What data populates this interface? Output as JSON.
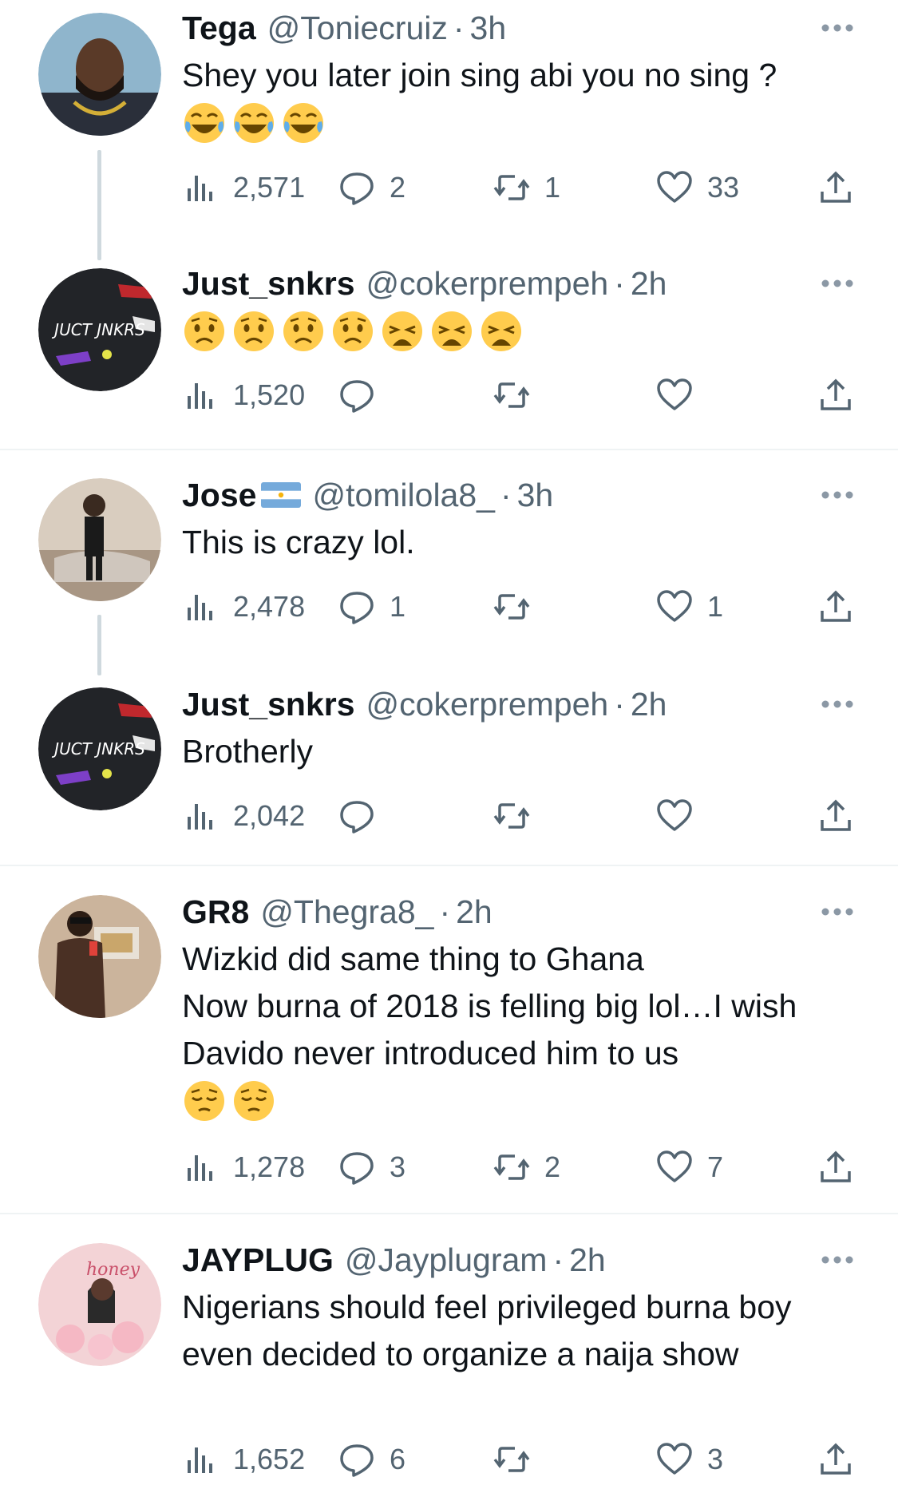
{
  "colors": {
    "text": "#0f1419",
    "secondary": "#536471",
    "divider": "#eff3f4",
    "thread_line": "#cfd9de"
  },
  "tweets": [
    {
      "name": "Tega",
      "handle": "@Toniecruiz",
      "time": "3h",
      "text": "Shey you later join sing abi you no sing ?",
      "emojis": [
        "face-with-tears-of-joy",
        "face-with-tears-of-joy",
        "face-with-tears-of-joy"
      ],
      "views": "2,571",
      "replies": "2",
      "retweets": "1",
      "likes": "33"
    },
    {
      "name": "Just_snkrs",
      "handle": "@cokerprempeh",
      "time": "2h",
      "text": "",
      "emojis": [
        "worried-face",
        "worried-face",
        "worried-face",
        "worried-face",
        "weary-face",
        "weary-face",
        "weary-face"
      ],
      "views": "1,520",
      "replies": "",
      "retweets": "",
      "likes": "",
      "avatar_text": "JUCT JNKRS"
    },
    {
      "name": "Jose",
      "handle": "@tomilola8_",
      "time": "3h",
      "text": "This is crazy lol.",
      "emojis": [],
      "views": "2,478",
      "replies": "1",
      "retweets": "",
      "likes": "1"
    },
    {
      "name": "Just_snkrs",
      "handle": "@cokerprempeh",
      "time": "2h",
      "text": "Brotherly",
      "emojis": [],
      "views": "2,042",
      "replies": "",
      "retweets": "",
      "likes": "",
      "avatar_text": "JUCT JNKRS"
    },
    {
      "name": "GR8",
      "handle": "@Thegra8_",
      "time": "2h",
      "text": "Wizkid did same  thing to Ghana\nNow burna of 2018 is felling big lol…I wish Davido never introduced him to us",
      "emojis": [
        "pensive-face",
        "pensive-face"
      ],
      "views": "1,278",
      "replies": "3",
      "retweets": "2",
      "likes": "7"
    },
    {
      "name": "JAYPLUG",
      "handle": "@Jayplugram",
      "time": "2h",
      "text": "Nigerians should feel privileged burna boy even decided to organize a naija show",
      "emojis": [],
      "views": "1,652",
      "replies": "6",
      "retweets": "",
      "likes": "3"
    }
  ]
}
